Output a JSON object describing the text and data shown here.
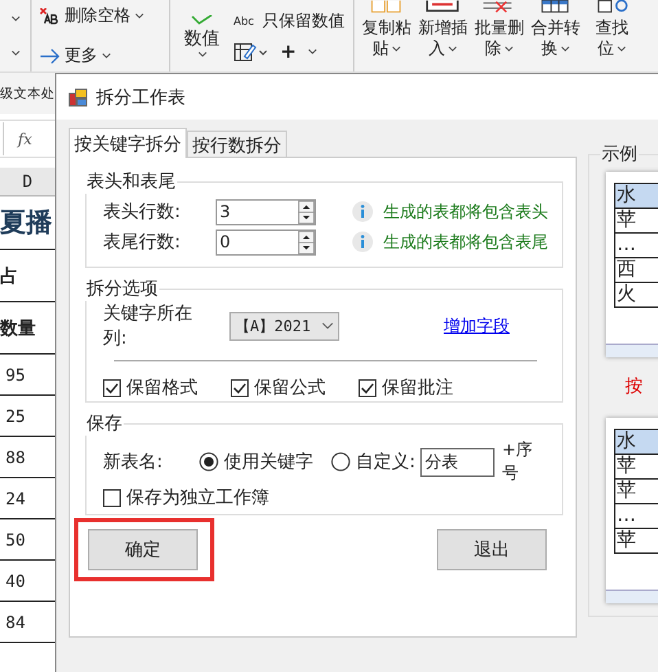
{
  "ribbon": {
    "text_tools": [
      {
        "kind": "delete",
        "label": "删除空格"
      },
      {
        "kind": "more",
        "label": "更多"
      }
    ],
    "value_button": {
      "label": "数值"
    },
    "value_tools": [
      {
        "kind": "abc",
        "icon_text": "Abc",
        "label": "只保留数值"
      },
      {
        "kind": "edit"
      },
      {
        "kind": "plus",
        "label": "+"
      }
    ],
    "large_buttons": [
      {
        "kind": "copy",
        "lines": [
          "复制粘",
          "贴"
        ]
      },
      {
        "kind": "insert",
        "lines": [
          "新增插",
          "入"
        ]
      },
      {
        "kind": "delete",
        "lines": [
          "批量删",
          "除"
        ]
      },
      {
        "kind": "merge",
        "lines": [
          "合并转",
          "换"
        ]
      },
      {
        "kind": "find",
        "lines": [
          "查找",
          "位"
        ]
      }
    ],
    "group_label": "级文本处"
  },
  "formula_bar": {
    "fx": "fx"
  },
  "sheet": {
    "column": "D",
    "cells": [
      {
        "kind": "title",
        "text": "夏播"
      },
      {
        "kind": "header",
        "text": "占"
      },
      {
        "kind": "header",
        "text": "数量"
      },
      {
        "kind": "value",
        "text": "95"
      },
      {
        "kind": "value",
        "text": "25"
      },
      {
        "kind": "value",
        "text": "88"
      },
      {
        "kind": "value",
        "text": "24"
      },
      {
        "kind": "value",
        "text": "50"
      },
      {
        "kind": "value",
        "text": "40"
      },
      {
        "kind": "value",
        "text": "84"
      }
    ]
  },
  "dialog": {
    "title": "拆分工作表",
    "tabs": [
      {
        "label": "按关键字拆分",
        "selected": true
      },
      {
        "label": "按行数拆分",
        "selected": false
      }
    ],
    "header_footer": {
      "title": "表头和表尾",
      "rows": [
        {
          "label": "表头行数:",
          "value": "3",
          "note": "生成的表都将包含表头"
        },
        {
          "label": "表尾行数:",
          "value": "0",
          "note": "生成的表都将包含表尾"
        }
      ]
    },
    "split_options": {
      "title": "拆分选项",
      "key_column_label": "关键字所在列:",
      "key_column_value": "【A】2021",
      "add_field_link": "增加字段",
      "checkboxes": [
        {
          "label": "保留格式",
          "checked": true
        },
        {
          "label": "保留公式",
          "checked": true
        },
        {
          "label": "保留批注",
          "checked": true
        }
      ]
    },
    "save": {
      "title": "保存",
      "name_label": "新表名:",
      "options": [
        {
          "label": "使用关键字",
          "selected": true
        },
        {
          "label": "自定义:",
          "selected": false
        }
      ],
      "custom_value": "分表",
      "suffix": "+序号",
      "separate_workbook": {
        "label": "保存为独立工作簿",
        "checked": false
      }
    },
    "buttons": [
      {
        "label": "确定",
        "highlighted": true
      },
      {
        "label": "退出",
        "highlighted": false
      }
    ],
    "example": {
      "title": "示例",
      "previews": [
        {
          "cells": [
            "水",
            "苹",
            "…",
            "西",
            "火"
          ]
        },
        {
          "cells": [
            "水",
            "苹",
            "苹",
            "…",
            "苹"
          ]
        }
      ],
      "note": "按"
    }
  }
}
